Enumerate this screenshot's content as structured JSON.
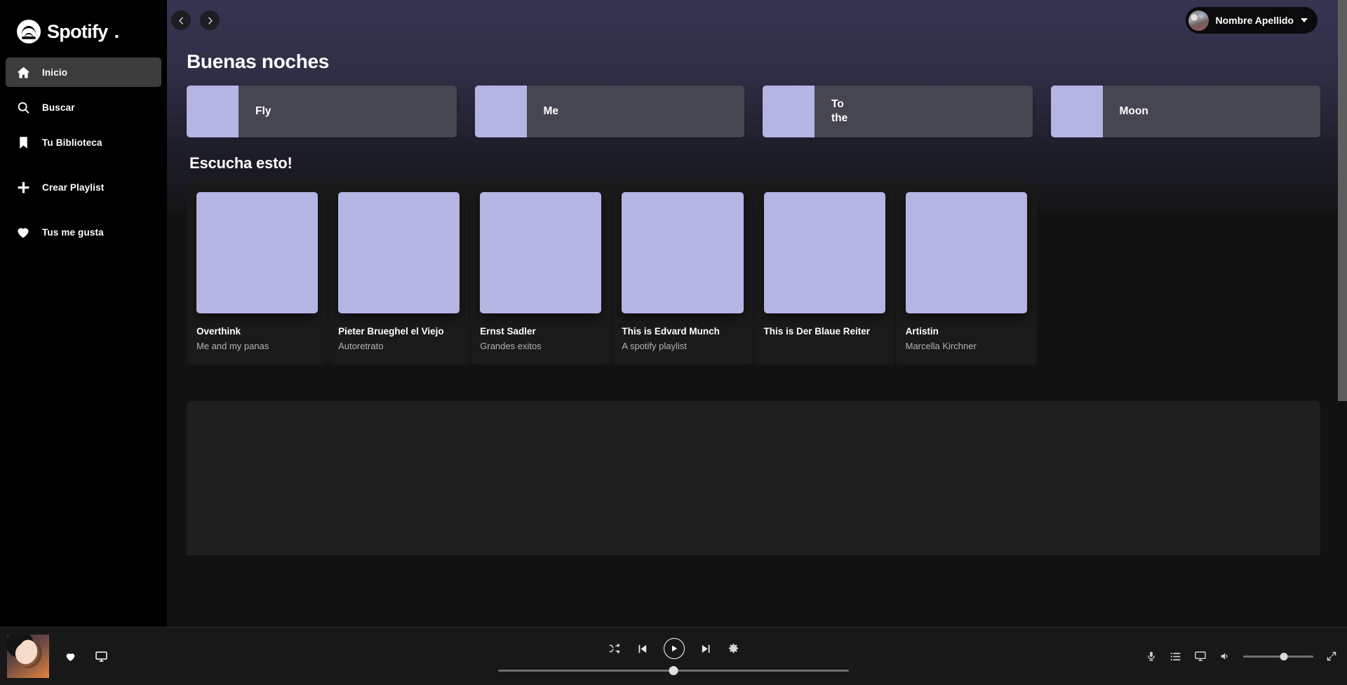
{
  "brand": {
    "name": "Spotify",
    "logo_icon": "spotify-logo-icon"
  },
  "sidebar": {
    "items": [
      {
        "label": "Inicio",
        "icon": "home-icon",
        "active": true
      },
      {
        "label": "Buscar",
        "icon": "search-icon",
        "active": false
      },
      {
        "label": "Tu Biblioteca",
        "icon": "bookmark-icon",
        "active": false
      },
      {
        "label": "Crear Playlist",
        "icon": "plus-icon",
        "active": false
      },
      {
        "label": "Tus me gusta",
        "icon": "heart-icon",
        "active": false
      }
    ]
  },
  "topbar": {
    "back_icon": "chevron-left-icon",
    "forward_icon": "chevron-right-icon",
    "user_name": "Nombre Apellido",
    "avatar_icon": "avatar",
    "caret_icon": "chevron-down-icon"
  },
  "main": {
    "greeting": "Buenas noches",
    "shortcuts": [
      {
        "title": "Fly",
        "title2": ""
      },
      {
        "title": "Me",
        "title2": ""
      },
      {
        "title": "To",
        "title2": "the"
      },
      {
        "title": "Moon",
        "title2": ""
      }
    ],
    "section_title": "Escucha esto!",
    "cards": [
      {
        "title": "Overthink",
        "subtitle": "Me and my panas"
      },
      {
        "title": "Pieter Brueghel el Viejo",
        "subtitle": "Autoretrato"
      },
      {
        "title": "Ernst Sadler",
        "subtitle": "Grandes exitos"
      },
      {
        "title": "This is Edvard Munch",
        "subtitle": "A spotify playlist"
      },
      {
        "title": "This is Der Blaue Reiter",
        "subtitle": ""
      },
      {
        "title": "Artistin",
        "subtitle": "Marcella Kirchner"
      }
    ]
  },
  "player": {
    "now_playing_art": "album-art-thumbnail",
    "like_icon": "heart-icon",
    "device_icon": "monitor-icon",
    "shuffle_icon": "shuffle-icon",
    "previous_icon": "previous-track-icon",
    "play_icon": "play-icon",
    "next_icon": "next-track-icon",
    "settings_icon": "gear-icon",
    "progress_percent": 50,
    "mic_icon": "microphone-icon",
    "queue_icon": "queue-list-icon",
    "connect_icon": "monitor-icon",
    "volume_icon": "speaker-icon",
    "volume_percent": 58,
    "fullscreen_icon": "expand-icon"
  },
  "colors": {
    "accent_purple": "#b5b5e3",
    "hero_top": "#353552",
    "card_bg": "#1a1a1a",
    "shortcut_bg": "#464650",
    "sidebar_bg": "#000000",
    "player_bg": "#181818",
    "text_muted": "#b3b3b3"
  }
}
